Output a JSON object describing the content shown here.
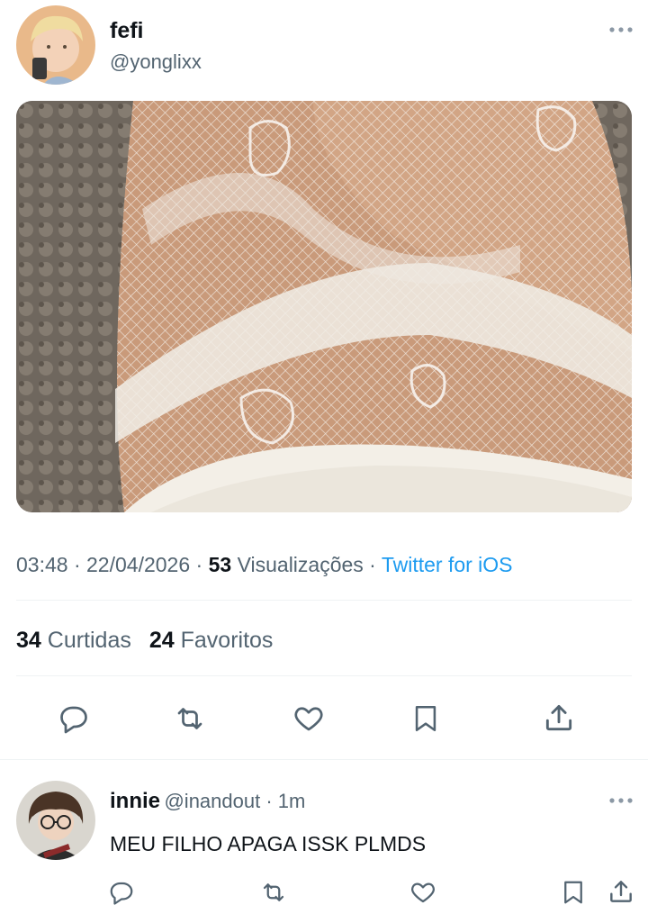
{
  "tweet": {
    "author_name": "fefi",
    "author_handle": "@yonglixx",
    "more_icon": "more-horizontal-icon",
    "time": "03:48",
    "sep1": " · ",
    "date": "22/04/2026",
    "sep2": " · ",
    "views_count": "53",
    "views_label": " Visualizações",
    "sep3": " · ",
    "source": "Twitter for iOS",
    "likes_count": "34",
    "likes_label": " Curtidas",
    "favorites_count": "24",
    "favorites_label": " Favoritos",
    "actions": [
      "reply-icon",
      "retweet-icon",
      "like-icon",
      "bookmark-icon",
      "share-icon"
    ]
  },
  "reply": {
    "author_name": "innie",
    "author_handle": "@inandout",
    "sep": " · ",
    "time": "1m",
    "text": "MEU FILHO APAGA ISSK PLMDS",
    "actions": [
      "reply-icon",
      "retweet-icon",
      "like-icon",
      "bookmark-icon",
      "share-icon"
    ]
  },
  "colors": {
    "text_primary": "#0f1419",
    "text_secondary": "#536471",
    "link": "#1d9bf0",
    "divider": "#eff3f4"
  }
}
